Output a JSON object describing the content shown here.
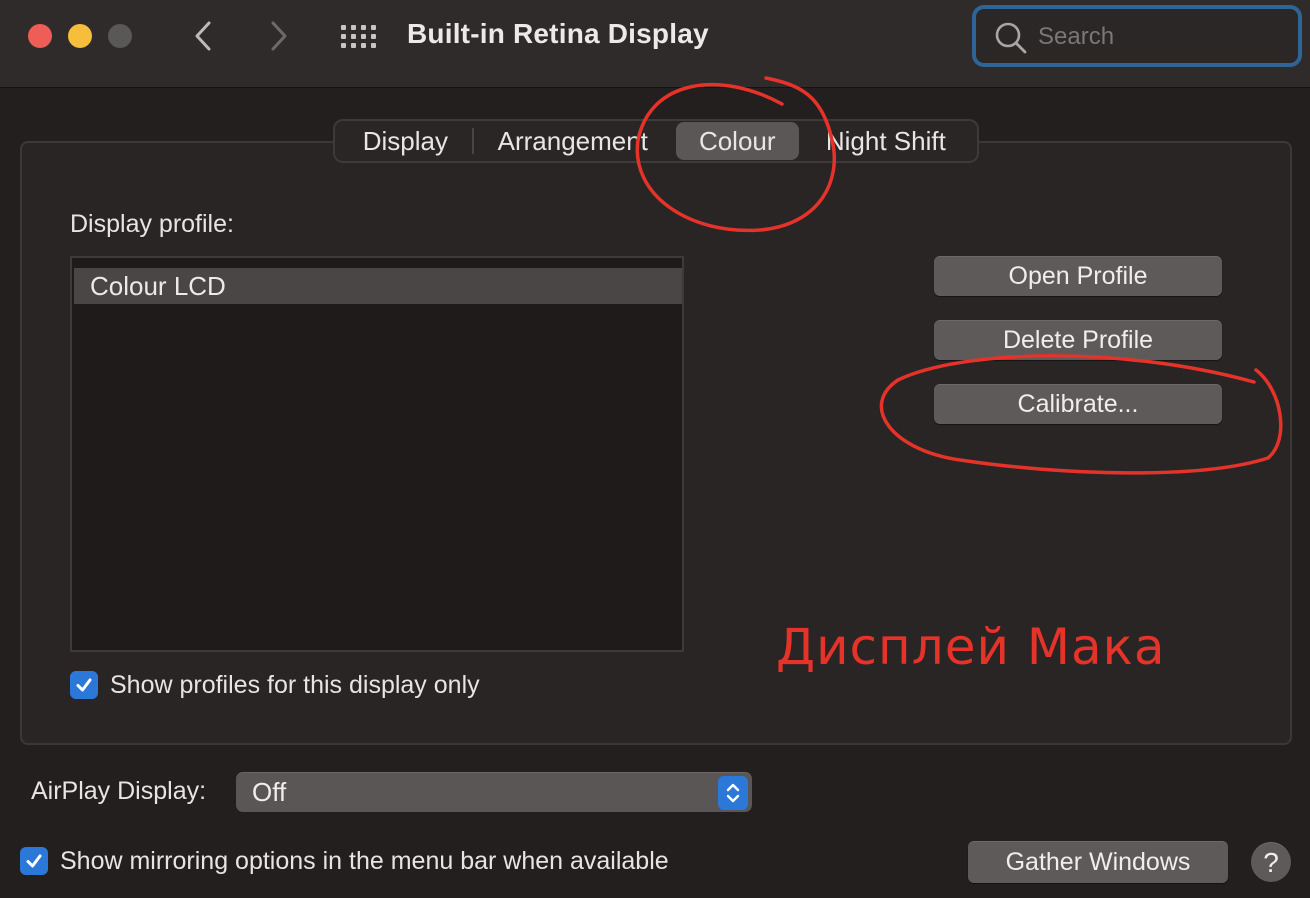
{
  "window": {
    "title": "Built-in Retina Display",
    "search_placeholder": "Search"
  },
  "tabs": [
    {
      "label": "Display",
      "selected": false
    },
    {
      "label": "Arrangement",
      "selected": false
    },
    {
      "label": "Colour",
      "selected": true
    },
    {
      "label": "Night Shift",
      "selected": false
    }
  ],
  "colour": {
    "profile_label": "Display profile:",
    "profiles": [
      "Colour LCD"
    ],
    "selected_profile": "Colour LCD",
    "buttons": {
      "open": "Open Profile",
      "delete": "Delete Profile",
      "calibrate": "Calibrate..."
    },
    "show_profiles_label": "Show profiles for this display only",
    "show_profiles_checked": true
  },
  "airplay": {
    "label": "AirPlay Display:",
    "value": "Off"
  },
  "mirroring": {
    "label": "Show mirroring options in the menu bar when available",
    "checked": true
  },
  "footer": {
    "gather_windows": "Gather Windows",
    "help": "?"
  },
  "annotation": {
    "text": "Дисплей Мака",
    "color": "#e6332a"
  },
  "colors": {
    "accent": "#2b78d9",
    "focus_ring": "#2e6496",
    "close": "#ee5e56",
    "minimize": "#f5be3b",
    "maximize": "#5a5757"
  }
}
